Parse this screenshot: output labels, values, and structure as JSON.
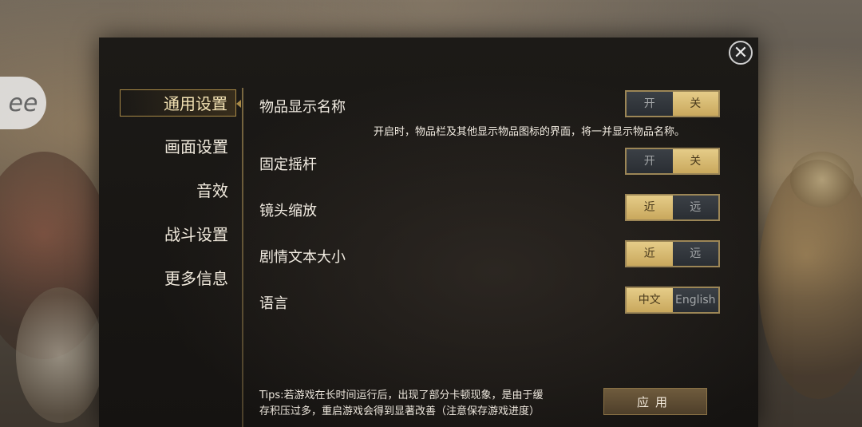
{
  "brand": {
    "logo_text": "ee"
  },
  "close_button": {
    "icon": "close-icon",
    "glyph": "✕"
  },
  "sidebar": {
    "items": [
      {
        "label": "通用设置",
        "active": true
      },
      {
        "label": "画面设置",
        "active": false
      },
      {
        "label": "音效",
        "active": false
      },
      {
        "label": "战斗设置",
        "active": false
      },
      {
        "label": "更多信息",
        "active": false
      }
    ]
  },
  "settings": {
    "item_name": {
      "label": "物品显示名称",
      "description": "开启时，物品栏及其他显示物品图标的界面，将一并显示物品名称。",
      "options": [
        "开",
        "关"
      ],
      "selected": "关"
    },
    "fixed_joystick": {
      "label": "固定摇杆",
      "options": [
        "开",
        "关"
      ],
      "selected": "关"
    },
    "camera_zoom": {
      "label": "镜头缩放",
      "options": [
        "近",
        "远"
      ],
      "selected": "近"
    },
    "story_text_size": {
      "label": "剧情文本大小",
      "options": [
        "近",
        "远"
      ],
      "selected": "近"
    },
    "language": {
      "label": "语言",
      "options": [
        "中文",
        "English"
      ],
      "selected": "中文"
    }
  },
  "tips": {
    "line1": "Tips:若游戏在长时间运行后，出现了部分卡顿现象，是由于缓",
    "line2": "存积压过多，重启游戏会得到显著改善（注意保存游戏进度）"
  },
  "apply_button": {
    "label": "应用"
  },
  "colors": {
    "accent_gold": "#c9a85d",
    "panel_bg": "#1c1a17",
    "toggle_off": "#2e3237"
  }
}
